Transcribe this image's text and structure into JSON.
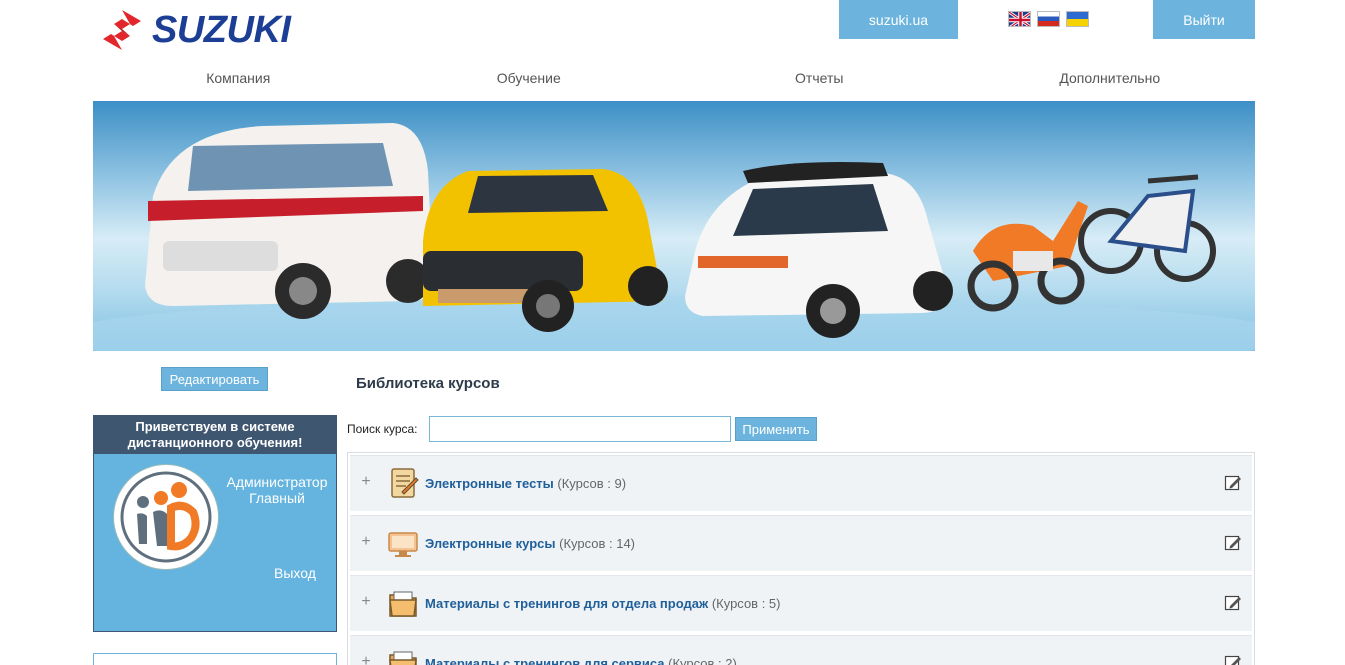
{
  "header": {
    "brand": "SUZUKI",
    "site_button": "suzuki.ua",
    "exit_button": "Выйти",
    "flags": [
      "english-flag-icon",
      "russian-flag-icon",
      "ukrainian-flag-icon"
    ]
  },
  "nav": {
    "items": [
      "Компания",
      "Обучение",
      "Отчеты",
      "Дополнительно"
    ]
  },
  "sidebar": {
    "edit_button": "Редактировать",
    "welcome_title": "Приветствуем в системе дистанционного обучения!",
    "user_role": "Администратор",
    "user_name": "Главный",
    "logout": "Выход"
  },
  "main": {
    "title": "Библиотека курсов",
    "search_label": "Поиск курса:",
    "search_value": "",
    "apply_button": "Применить",
    "categories": [
      {
        "name": "Электронные тесты",
        "count": "(Курсов : 9)",
        "icon": "test-icon"
      },
      {
        "name": "Электронные курсы",
        "count": "(Курсов : 14)",
        "icon": "computer-icon"
      },
      {
        "name": "Материалы с тренингов для отдела продаж",
        "count": "(Курсов : 5)",
        "icon": "folder-icon"
      },
      {
        "name": "Материалы с тренингов для сервиса",
        "count": "(Курсов : 2)",
        "icon": "folder-icon"
      }
    ]
  },
  "colors": {
    "accent": "#6cb4dd",
    "brand_blue": "#1c3f95",
    "brand_red": "#e3262b",
    "welcome_header": "#3f5670",
    "link": "#1f5f9a"
  }
}
